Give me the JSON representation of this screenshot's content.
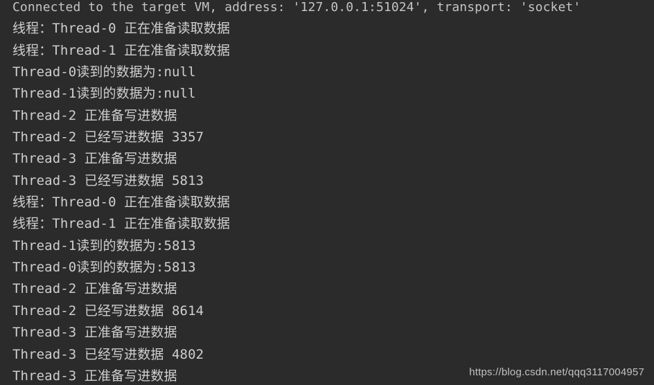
{
  "window": {
    "app": "IntelliJ IDEA Run Console",
    "background_color": "#2b2b2b",
    "text_color": "#cfcfcf"
  },
  "console": {
    "lines": [
      {
        "text": "Connected to the target VM, address: '127.0.0.1:51024', transport: 'socket'",
        "kind": "system"
      },
      {
        "text": "线程：Thread-0 正在准备读取数据",
        "kind": "stdout"
      },
      {
        "text": "线程：Thread-1 正在准备读取数据",
        "kind": "stdout"
      },
      {
        "text": "Thread-0读到的数据为:null",
        "kind": "stdout"
      },
      {
        "text": "Thread-1读到的数据为:null",
        "kind": "stdout"
      },
      {
        "text": "Thread-2 正准备写进数据",
        "kind": "stdout"
      },
      {
        "text": "Thread-2 已经写进数据 3357",
        "kind": "stdout"
      },
      {
        "text": "Thread-3 正准备写进数据",
        "kind": "stdout"
      },
      {
        "text": "Thread-3 已经写进数据 5813",
        "kind": "stdout"
      },
      {
        "text": "线程：Thread-0 正在准备读取数据",
        "kind": "stdout"
      },
      {
        "text": "线程：Thread-1 正在准备读取数据",
        "kind": "stdout"
      },
      {
        "text": "Thread-1读到的数据为:5813",
        "kind": "stdout"
      },
      {
        "text": "Thread-0读到的数据为:5813",
        "kind": "stdout"
      },
      {
        "text": "Thread-2 正准备写进数据",
        "kind": "stdout"
      },
      {
        "text": "Thread-2 已经写进数据 8614",
        "kind": "stdout"
      },
      {
        "text": "Thread-3 正准备写进数据",
        "kind": "stdout"
      },
      {
        "text": "Thread-3 已经写进数据 4802",
        "kind": "stdout"
      },
      {
        "text": "Thread-3 正准备写进数据",
        "kind": "stdout"
      }
    ]
  },
  "watermark": {
    "text": "https://blog.csdn.net/qqq3117004957"
  }
}
